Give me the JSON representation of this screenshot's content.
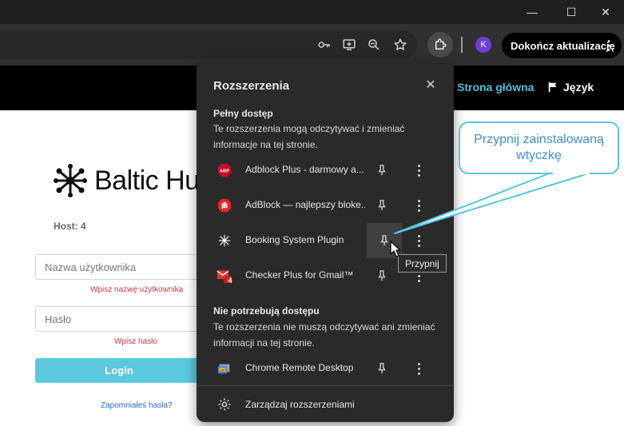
{
  "browser": {
    "window_controls": {
      "minimize": "—",
      "maximize": "☐",
      "close": "✕"
    },
    "toolbar": {
      "icons": [
        "key-icon",
        "install-app-icon",
        "zoom-icon",
        "bookmark-star-icon",
        "extensions-puzzle-icon"
      ],
      "profile_initial": "K",
      "update_button_label": "Dokończ aktualizację"
    }
  },
  "site": {
    "nav": {
      "home": "Strona główna",
      "language": "Język"
    },
    "logo_text": "Baltic Hu",
    "host": "Host: 4",
    "username_placeholder": "Nazwa użytkownika",
    "username_error": "Wpisz nazwę użytkownika",
    "password_placeholder": "Hasło",
    "password_error": "Wpisz hasło",
    "login_button": "Login",
    "forgot_link": "Zapomniałeś hasła?"
  },
  "extensions_popup": {
    "title": "Rozszerzenia",
    "full_access": {
      "heading": "Pełny dostęp",
      "description": "Te rozszerzenia mogą odczytywać i zmieniać informacje na tej stronie.",
      "items": [
        {
          "name": "Adblock Plus - darmowy a...",
          "icon": "adblock-plus-icon"
        },
        {
          "name": "AdBlock — najlepszy bloke...",
          "icon": "adblock-hand-icon"
        },
        {
          "name": "Booking System Plugin",
          "icon": "booking-plugin-icon"
        },
        {
          "name": "Checker Plus for Gmail™",
          "icon": "gmail-checker-icon",
          "badge": "4"
        }
      ]
    },
    "no_access": {
      "heading": "Nie potrzebują dostępu",
      "description": "Te rozszerzenia nie muszą odczytywać ani zmieniać informacji na tej stronie.",
      "items": [
        {
          "name": "Chrome Remote Desktop",
          "icon": "remote-desktop-icon"
        }
      ]
    },
    "manage_label": "Zarządzaj rozszerzeniami",
    "pin_tooltip": "Przypnij"
  },
  "callout": {
    "text": "Przypnij zainstalowaną wtyczkę"
  },
  "colors": {
    "accent": "#4fc1e0",
    "popup_bg": "#2a2a2a",
    "error": "#d9363e",
    "callout_border": "#58c4dd"
  }
}
